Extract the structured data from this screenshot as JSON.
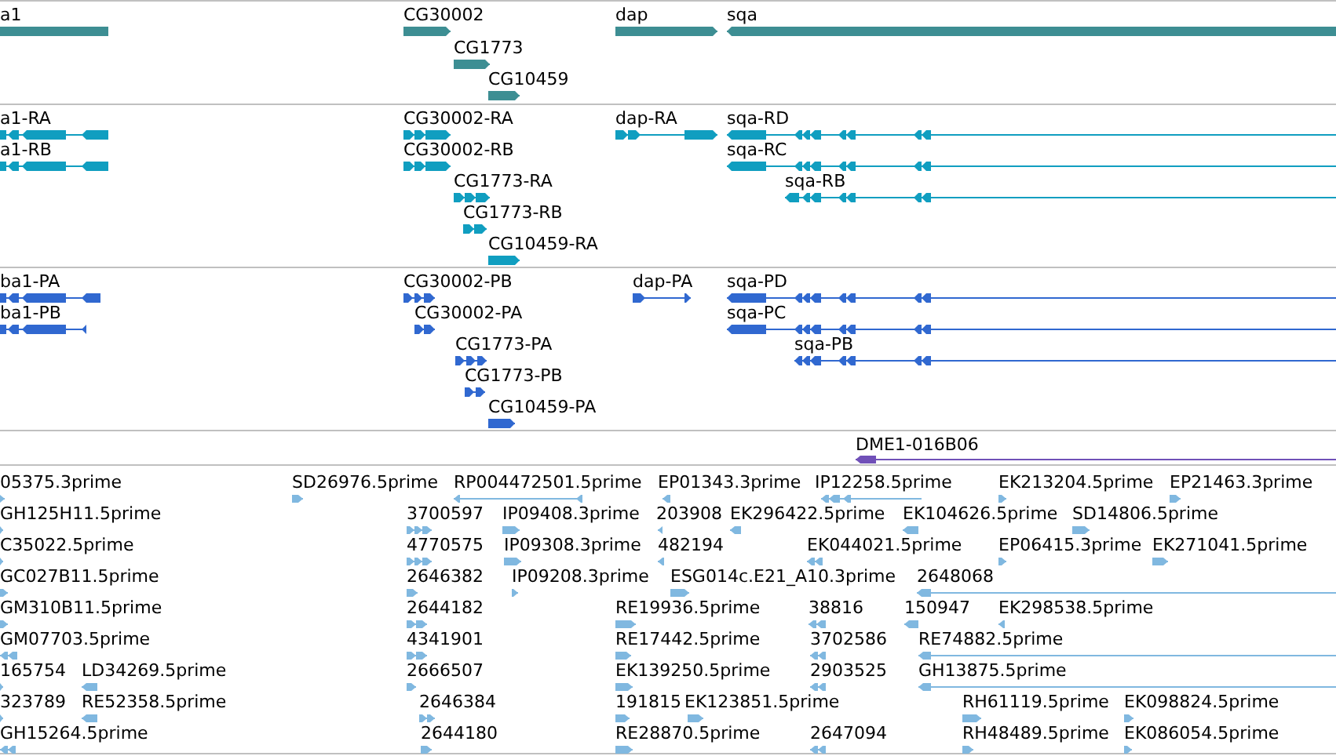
{
  "tracks": [
    {
      "kind": "gene",
      "color": "#3d8e93",
      "features": [
        {
          "label": "a1",
          "reverse": true
        },
        {
          "label": "CG30002",
          "reverse": false
        },
        {
          "label": "CG1773",
          "reverse": false
        },
        {
          "label": "CG10459",
          "reverse": false
        },
        {
          "label": "dap",
          "reverse": false
        },
        {
          "label": "sqa",
          "reverse": true
        }
      ]
    },
    {
      "kind": "transcript",
      "color": "#109ec0",
      "features": [
        {
          "label": "a1-RA",
          "reverse": true
        },
        {
          "label": "a1-RB",
          "reverse": true
        },
        {
          "label": "CG30002-RA",
          "reverse": false
        },
        {
          "label": "CG30002-RB",
          "reverse": false
        },
        {
          "label": "CG1773-RA",
          "reverse": false
        },
        {
          "label": "CG1773-RB",
          "reverse": false
        },
        {
          "label": "CG10459-RA",
          "reverse": false
        },
        {
          "label": "dap-RA",
          "reverse": false
        },
        {
          "label": "sqa-RD",
          "reverse": true
        },
        {
          "label": "sqa-RC",
          "reverse": true
        },
        {
          "label": "sqa-RB",
          "reverse": true
        }
      ]
    },
    {
      "kind": "protein",
      "color": "#3068d0",
      "features": [
        {
          "label": "ba1-PA",
          "reverse": true
        },
        {
          "label": "ba1-PB",
          "reverse": true
        },
        {
          "label": "CG30002-PB",
          "reverse": false
        },
        {
          "label": "CG30002-PA",
          "reverse": false
        },
        {
          "label": "CG1773-PA",
          "reverse": false
        },
        {
          "label": "CG1773-PB",
          "reverse": false
        },
        {
          "label": "CG10459-PA",
          "reverse": false
        },
        {
          "label": "dap-PA",
          "reverse": false
        },
        {
          "label": "sqa-PD",
          "reverse": true
        },
        {
          "label": "sqa-PC",
          "reverse": true
        },
        {
          "label": "sqa-PB",
          "reverse": true
        }
      ]
    },
    {
      "kind": "clone",
      "color": "#7050b8",
      "features": [
        {
          "label": "DME1-016B06",
          "reverse": true
        }
      ]
    },
    {
      "kind": "est",
      "color": "#80b8e0",
      "features": [
        {
          "label": "05375.3prime",
          "reverse": false
        },
        {
          "label": "SD26976.5prime",
          "reverse": false
        },
        {
          "label": "RP004472501.5prime",
          "reverse": true
        },
        {
          "label": "EP01343.3prime",
          "reverse": true
        },
        {
          "label": "IP12258.5prime",
          "reverse": true
        },
        {
          "label": "EK213204.5prime",
          "reverse": false
        },
        {
          "label": "EP21463.3prime",
          "reverse": false
        },
        {
          "label": "GH125H11.5prime",
          "reverse": false
        },
        {
          "label": "3700597",
          "reverse": false
        },
        {
          "label": "IP09408.3prime",
          "reverse": false
        },
        {
          "label": "203908",
          "reverse": true
        },
        {
          "label": "EK296422.5prime",
          "reverse": true
        },
        {
          "label": "EK104626.5prime",
          "reverse": true
        },
        {
          "label": "SD14806.5prime",
          "reverse": false
        },
        {
          "label": "C35022.5prime",
          "reverse": false
        },
        {
          "label": "4770575",
          "reverse": false
        },
        {
          "label": "IP09308.3prime",
          "reverse": false
        },
        {
          "label": "482194",
          "reverse": true
        },
        {
          "label": "EK044021.5prime",
          "reverse": true
        },
        {
          "label": "EP06415.3prime",
          "reverse": false
        },
        {
          "label": "EK271041.5prime",
          "reverse": false
        },
        {
          "label": "GC027B11.5prime",
          "reverse": false
        },
        {
          "label": "2646382",
          "reverse": false
        },
        {
          "label": "IP09208.3prime",
          "reverse": false
        },
        {
          "label": "ESG014c.E21_A10.3prime",
          "reverse": false
        },
        {
          "label": "2648068",
          "reverse": true
        },
        {
          "label": "GM310B11.5prime",
          "reverse": false
        },
        {
          "label": "2644182",
          "reverse": false
        },
        {
          "label": "RE19936.5prime",
          "reverse": false
        },
        {
          "label": "38816",
          "reverse": true
        },
        {
          "label": "150947",
          "reverse": true
        },
        {
          "label": "EK298538.5prime",
          "reverse": true
        },
        {
          "label": "GM07703.5prime",
          "reverse": true
        },
        {
          "label": "4341901",
          "reverse": false
        },
        {
          "label": "RE17442.5prime",
          "reverse": false
        },
        {
          "label": "3702586",
          "reverse": true
        },
        {
          "label": "RE74882.5prime",
          "reverse": true
        },
        {
          "label": "165754",
          "reverse": false
        },
        {
          "label": "LD34269.5prime",
          "reverse": true
        },
        {
          "label": "2666507",
          "reverse": false
        },
        {
          "label": "EK139250.5prime",
          "reverse": false
        },
        {
          "label": "2903525",
          "reverse": true
        },
        {
          "label": "GH13875.5prime",
          "reverse": true
        },
        {
          "label": "323789",
          "reverse": false
        },
        {
          "label": "RE52358.5prime",
          "reverse": true
        },
        {
          "label": "2646384",
          "reverse": false
        },
        {
          "label": "191815",
          "reverse": false
        },
        {
          "label": "EK123851.5prime",
          "reverse": false
        },
        {
          "label": "RH61119.5prime",
          "reverse": false
        },
        {
          "label": "EK098824.5prime",
          "reverse": false
        },
        {
          "label": "GH15264.5prime",
          "reverse": true
        },
        {
          "label": "2644180",
          "reverse": false
        },
        {
          "label": "RE28870.5prime",
          "reverse": false
        },
        {
          "label": "2647094",
          "reverse": true
        },
        {
          "label": "RH48489.5prime",
          "reverse": false
        },
        {
          "label": "EK086054.5prime",
          "reverse": false
        }
      ]
    }
  ]
}
